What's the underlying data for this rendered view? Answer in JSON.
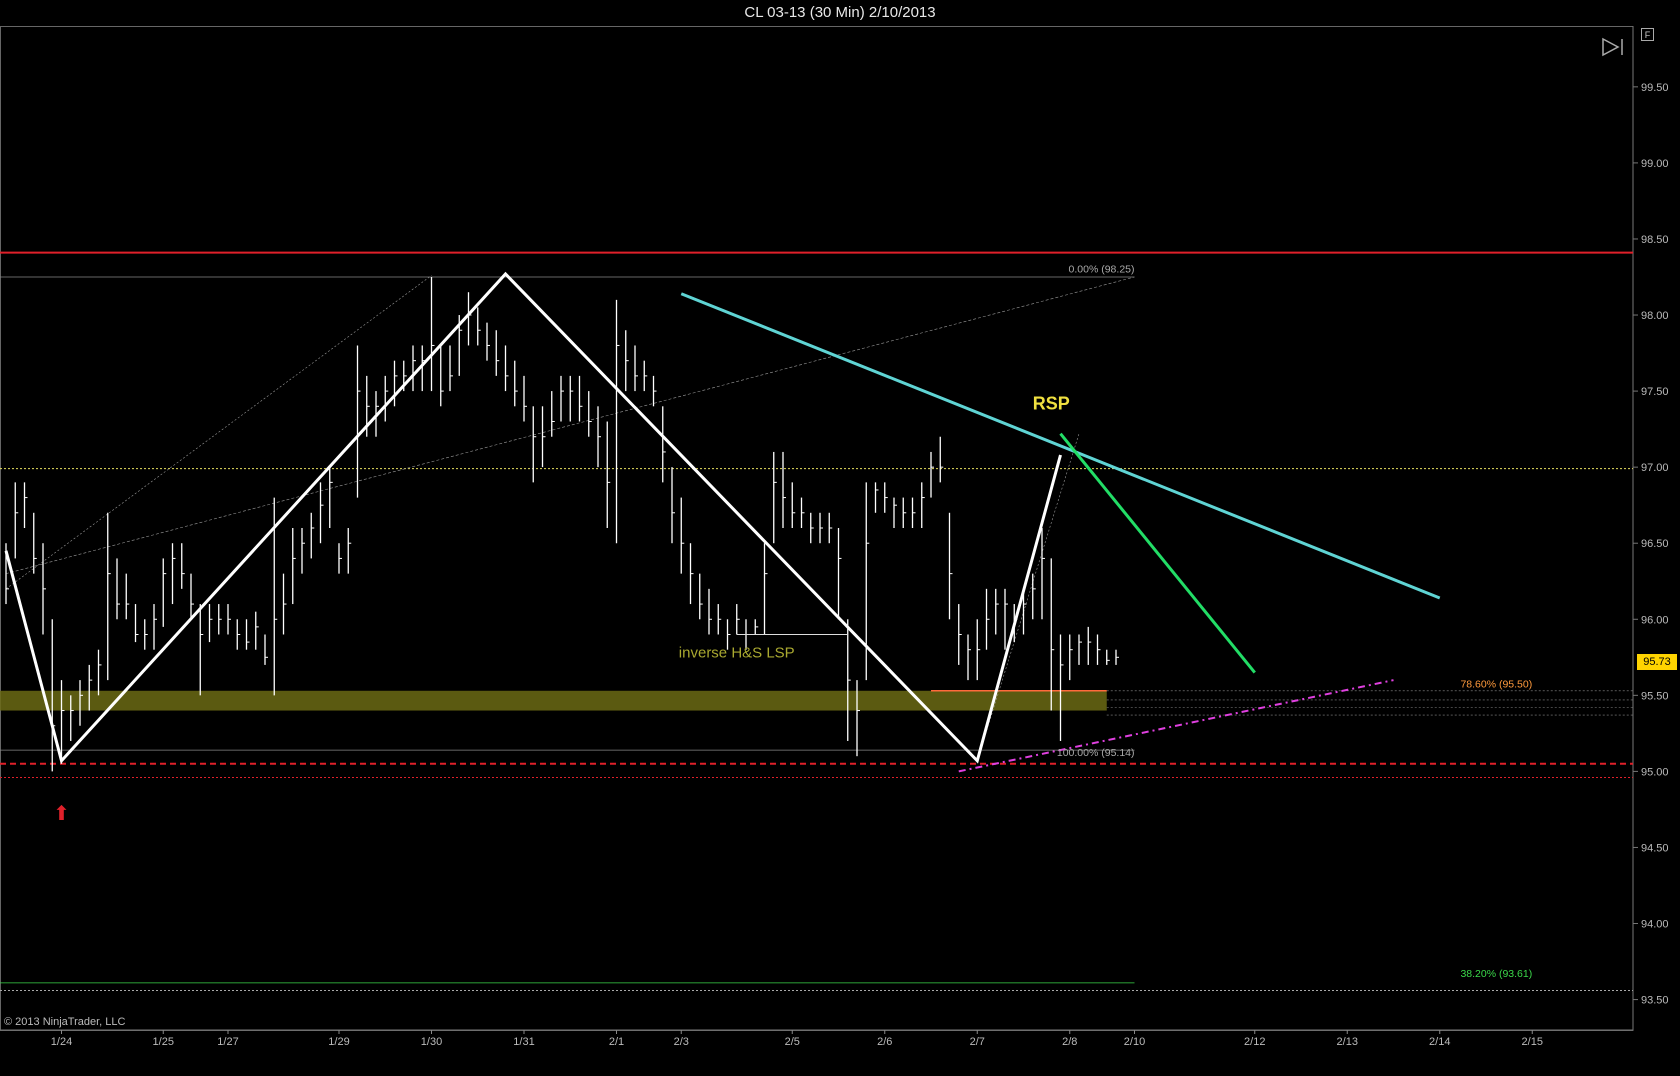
{
  "window": {
    "title": "CL 03-13 (30 Min)  2/10/2013"
  },
  "copyright": "© 2013 NinjaTrader, LLC",
  "buttons": {
    "float_label": "F",
    "play_icon": "play-end-icon"
  },
  "current_price": "95.73",
  "colors": {
    "background": "#000000",
    "bars": "#ffffff",
    "resistance": "#e0202a",
    "trend_cyan": "#5fd4d4",
    "trend_green": "#22dd66",
    "support_magenta": "#e040e0",
    "zone_fill": "#6b6a14",
    "rsp_label": "#f0e040",
    "pattern_label": "#a9a830",
    "fib_orange": "#ff9a3c",
    "fib_green": "#3bd84a"
  },
  "chart_data": {
    "type": "bar",
    "title": "CL 03-13 (30 Min)  2/10/2013",
    "y_axis": {
      "min": 93.3,
      "max": 99.9,
      "ticks": [
        "99.50",
        "99.00",
        "98.50",
        "98.00",
        "97.50",
        "97.00",
        "96.50",
        "96.00",
        "95.50",
        "95.00",
        "94.50",
        "94.00",
        "93.50"
      ],
      "tick_values": [
        99.5,
        99.0,
        98.5,
        98.0,
        97.5,
        97.0,
        96.5,
        96.0,
        95.5,
        95.0,
        94.5,
        94.0,
        93.5
      ]
    },
    "x_axis": {
      "labels": [
        "1/24",
        "1/25",
        "1/27",
        "1/29",
        "1/30",
        "1/31",
        "2/1",
        "2/3",
        "2/5",
        "2/6",
        "2/7",
        "2/8",
        "2/10",
        "2/12",
        "2/13",
        "2/14",
        "2/15"
      ],
      "label_index": [
        6,
        17,
        24,
        36,
        46,
        56,
        66,
        73,
        85,
        95,
        105,
        115,
        122,
        135,
        145,
        155,
        165
      ],
      "bar_count": 127,
      "total_slots": 172
    },
    "price_bars_hlc": [
      [
        96.5,
        96.1,
        96.2
      ],
      [
        96.9,
        96.4,
        96.7
      ],
      [
        96.9,
        96.6,
        96.8
      ],
      [
        96.7,
        96.3,
        96.4
      ],
      [
        96.5,
        95.9,
        96.2
      ],
      [
        96.0,
        95.0,
        95.3
      ],
      [
        95.6,
        95.05,
        95.4
      ],
      [
        95.5,
        95.2,
        95.4
      ],
      [
        95.6,
        95.3,
        95.5
      ],
      [
        95.7,
        95.4,
        95.6
      ],
      [
        95.8,
        95.5,
        95.7
      ],
      [
        96.7,
        95.6,
        96.3
      ],
      [
        96.4,
        96.0,
        96.1
      ],
      [
        96.3,
        96.0,
        96.1
      ],
      [
        96.1,
        95.85,
        95.9
      ],
      [
        96.0,
        95.8,
        95.9
      ],
      [
        96.1,
        95.8,
        96.0
      ],
      [
        96.4,
        95.95,
        96.3
      ],
      [
        96.5,
        96.1,
        96.4
      ],
      [
        96.5,
        96.2,
        96.3
      ],
      [
        96.3,
        96.0,
        96.1
      ],
      [
        96.1,
        95.5,
        95.9
      ],
      [
        96.1,
        95.85,
        96.0
      ],
      [
        96.1,
        95.9,
        96.0
      ],
      [
        96.1,
        95.9,
        96.0
      ],
      [
        96.0,
        95.8,
        95.9
      ],
      [
        96.0,
        95.8,
        95.85
      ],
      [
        96.05,
        95.8,
        95.95
      ],
      [
        95.9,
        95.7,
        95.75
      ],
      [
        96.8,
        95.5,
        96.0
      ],
      [
        96.3,
        95.9,
        96.1
      ],
      [
        96.6,
        96.1,
        96.4
      ],
      [
        96.6,
        96.3,
        96.5
      ],
      [
        96.7,
        96.4,
        96.6
      ],
      [
        96.9,
        96.5,
        96.75
      ],
      [
        97.0,
        96.6,
        96.9
      ],
      [
        96.5,
        96.3,
        96.4
      ],
      [
        96.6,
        96.3,
        96.5
      ],
      [
        97.8,
        96.8,
        97.5
      ],
      [
        97.6,
        97.2,
        97.4
      ],
      [
        97.5,
        97.2,
        97.4
      ],
      [
        97.6,
        97.3,
        97.5
      ],
      [
        97.7,
        97.4,
        97.6
      ],
      [
        97.7,
        97.5,
        97.6
      ],
      [
        97.8,
        97.5,
        97.7
      ],
      [
        97.8,
        97.5,
        97.7
      ],
      [
        98.25,
        97.5,
        97.8
      ],
      [
        97.8,
        97.4,
        97.5
      ],
      [
        97.8,
        97.5,
        97.6
      ],
      [
        98.0,
        97.6,
        97.9
      ],
      [
        98.15,
        97.8,
        98.0
      ],
      [
        98.05,
        97.8,
        97.9
      ],
      [
        97.95,
        97.7,
        97.8
      ],
      [
        97.9,
        97.6,
        97.7
      ],
      [
        97.8,
        97.5,
        97.6
      ],
      [
        97.7,
        97.4,
        97.5
      ],
      [
        97.6,
        97.3,
        97.4
      ],
      [
        97.4,
        96.9,
        97.2
      ],
      [
        97.4,
        97.0,
        97.2
      ],
      [
        97.5,
        97.2,
        97.3
      ],
      [
        97.6,
        97.3,
        97.5
      ],
      [
        97.6,
        97.3,
        97.5
      ],
      [
        97.6,
        97.3,
        97.4
      ],
      [
        97.5,
        97.2,
        97.3
      ],
      [
        97.4,
        97.0,
        97.2
      ],
      [
        97.3,
        96.6,
        96.9
      ],
      [
        98.1,
        96.5,
        97.8
      ],
      [
        97.9,
        97.5,
        97.7
      ],
      [
        97.8,
        97.5,
        97.6
      ],
      [
        97.7,
        97.5,
        97.6
      ],
      [
        97.6,
        97.4,
        97.5
      ],
      [
        97.4,
        96.9,
        97.1
      ],
      [
        97.0,
        96.5,
        96.7
      ],
      [
        96.8,
        96.3,
        96.5
      ],
      [
        96.5,
        96.1,
        96.3
      ],
      [
        96.3,
        96.0,
        96.1
      ],
      [
        96.2,
        95.9,
        96.0
      ],
      [
        96.1,
        95.9,
        96.0
      ],
      [
        96.0,
        95.8,
        95.9
      ],
      [
        96.1,
        95.9,
        96.0
      ],
      [
        96.0,
        95.8,
        95.9
      ],
      [
        96.0,
        95.9,
        95.95
      ],
      [
        96.5,
        95.9,
        96.3
      ],
      [
        97.1,
        96.5,
        96.9
      ],
      [
        97.1,
        96.6,
        96.8
      ],
      [
        96.9,
        96.6,
        96.7
      ],
      [
        96.8,
        96.6,
        96.7
      ],
      [
        96.7,
        96.5,
        96.6
      ],
      [
        96.7,
        96.5,
        96.6
      ],
      [
        96.7,
        96.5,
        96.6
      ],
      [
        96.6,
        96.0,
        96.4
      ],
      [
        96.0,
        95.2,
        95.6
      ],
      [
        95.6,
        95.1,
        95.4
      ],
      [
        96.9,
        95.6,
        96.5
      ],
      [
        96.9,
        96.7,
        96.85
      ],
      [
        96.9,
        96.7,
        96.8
      ],
      [
        96.8,
        96.6,
        96.75
      ],
      [
        96.8,
        96.6,
        96.7
      ],
      [
        96.8,
        96.6,
        96.7
      ],
      [
        96.9,
        96.6,
        96.8
      ],
      [
        97.1,
        96.8,
        97.0
      ],
      [
        97.2,
        96.9,
        97.0
      ],
      [
        96.7,
        96.0,
        96.3
      ],
      [
        96.1,
        95.7,
        95.9
      ],
      [
        95.9,
        95.6,
        95.8
      ],
      [
        96.0,
        95.6,
        95.8
      ],
      [
        96.2,
        95.8,
        96.0
      ],
      [
        96.2,
        95.9,
        96.1
      ],
      [
        96.2,
        95.8,
        96.1
      ],
      [
        96.1,
        95.85,
        96.0
      ],
      [
        96.2,
        95.9,
        96.1
      ],
      [
        96.3,
        96.0,
        96.2
      ],
      [
        96.6,
        96.0,
        96.4
      ],
      [
        96.4,
        95.4,
        95.8
      ],
      [
        95.9,
        95.2,
        95.7
      ],
      [
        95.9,
        95.6,
        95.8
      ],
      [
        95.9,
        95.7,
        95.85
      ],
      [
        95.95,
        95.7,
        95.85
      ],
      [
        95.9,
        95.7,
        95.8
      ],
      [
        95.8,
        95.7,
        95.73
      ],
      [
        95.8,
        95.7,
        95.75
      ]
    ],
    "horizontal_lines": [
      {
        "value": 98.41,
        "style": "solid",
        "color": "#e0202a"
      },
      {
        "value": 98.25,
        "style": "solid-thin",
        "color": "#888888"
      },
      {
        "value": 96.99,
        "style": "dotted",
        "color": "#e6e060"
      },
      {
        "value": 95.14,
        "style": "solid-thin",
        "color": "#888888"
      },
      {
        "value": 95.05,
        "style": "dashed",
        "color": "#e0202a"
      },
      {
        "value": 94.96,
        "style": "dotted",
        "color": "#e0202a"
      },
      {
        "value": 93.61,
        "style": "solid-thin",
        "color": "#3bd84a"
      },
      {
        "value": 93.56,
        "style": "dotted",
        "color": "#aaaaaa"
      }
    ],
    "zone": {
      "top": 95.53,
      "bottom": 95.4
    },
    "zigzag": [
      [
        0,
        96.45
      ],
      [
        6,
        95.07
      ],
      [
        54,
        98.27
      ],
      [
        105,
        95.07
      ],
      [
        114,
        97.08
      ]
    ],
    "trend_lines": [
      {
        "name": "",
        "from": [
          73,
          98.14
        ],
        "to": [
          155,
          96.14
        ],
        "color": "#5fd4d4"
      },
      {
        "name": "",
        "from": [
          114,
          97.22
        ],
        "to": [
          135,
          95.65
        ],
        "color": "#22dd66"
      },
      {
        "name": "",
        "from": [
          103,
          95.0
        ],
        "to": [
          150,
          95.6
        ],
        "color": "#e040e0",
        "dashed": true
      }
    ],
    "annotations": [
      {
        "text": "RSP",
        "at": [
          113,
          97.38
        ],
        "color": "#f0e040"
      },
      {
        "text": "inverse H&S LSP",
        "at": [
          79,
          95.75
        ],
        "color": "#a9a830"
      },
      {
        "text": "0.00% (98.25)",
        "at": [
          122,
          98.28
        ],
        "color": "#aaaaaa"
      },
      {
        "text": "78.60% (95.50)",
        "at": [
          165,
          95.55
        ],
        "color": "#ff9a3c"
      },
      {
        "text": "100.00% (95.14)",
        "at": [
          122,
          95.1
        ],
        "color": "#aaaaaa"
      },
      {
        "text": "38.20% (93.61)",
        "at": [
          165,
          93.65
        ],
        "color": "#3bd84a"
      }
    ],
    "marker": {
      "label": "⬆",
      "at": [
        6,
        94.68
      ],
      "color": "#e0202a"
    }
  }
}
